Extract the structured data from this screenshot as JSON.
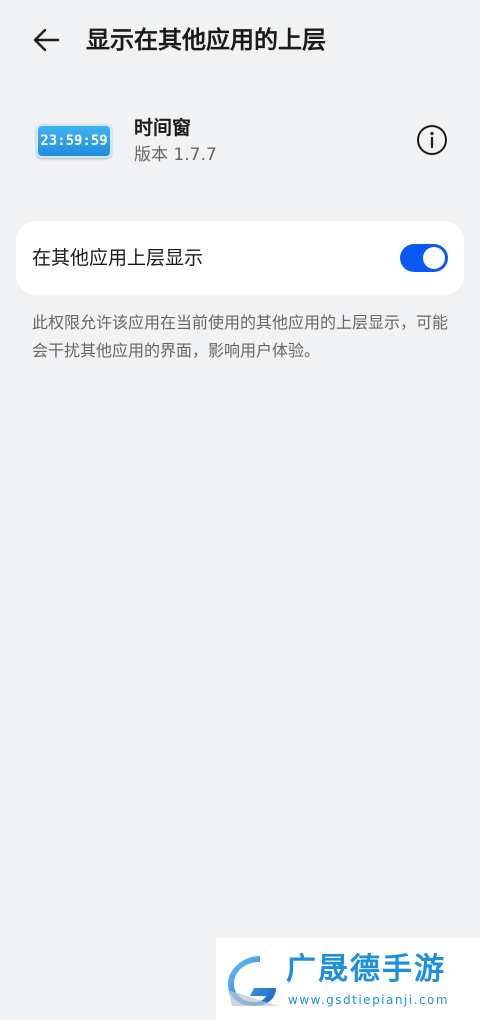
{
  "header": {
    "back_icon": "arrow-left-icon",
    "title": "显示在其他应用的上层"
  },
  "app": {
    "icon_text": "23:59:59",
    "name": "时间窗",
    "version": "版本 1.7.7",
    "info_icon": "info-circle-icon"
  },
  "setting": {
    "label": "在其他应用上层显示",
    "enabled": true,
    "accent_color": "#0a59f7"
  },
  "description": "此权限允许该应用在当前使用的其他应用的上层显示，可能会干扰其他应用的界面，影响用户体验。",
  "watermark": {
    "title": "广晟德手游",
    "url": "www.gsdtiepianji.com"
  }
}
